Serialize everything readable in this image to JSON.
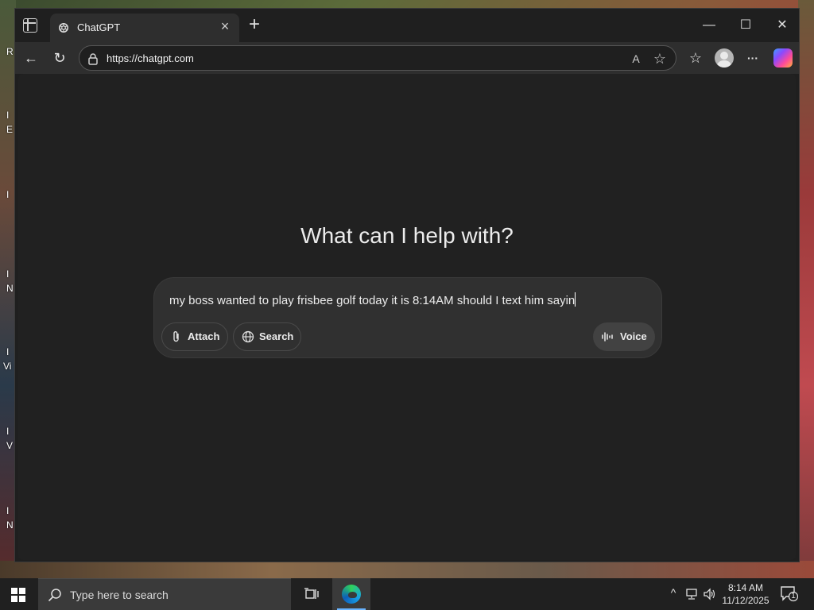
{
  "browser": {
    "tab_title": "ChatGPT",
    "url": "https://chatgpt.com",
    "new_tab_glyph": "+",
    "tab_close_glyph": "×"
  },
  "window_controls": {
    "minimize": "—",
    "maximize": "☐",
    "close": "✕"
  },
  "toolbar_icons": {
    "back": "←",
    "refresh": "↻",
    "read_aloud": "A",
    "favorite": "☆",
    "favorites_list": "☆",
    "more": "···"
  },
  "page": {
    "heading": "What can I help with?",
    "prompt_value": "my boss wanted to play frisbee golf today it is 8:14AM should I text him sayin",
    "attach_label": "Attach",
    "search_label": "Search",
    "voice_label": "Voice"
  },
  "desktop": {
    "letters": [
      "R",
      "I",
      "E",
      "I",
      "I",
      "N",
      "I",
      "Vi",
      "I",
      "V",
      "I",
      "N"
    ]
  },
  "taskbar": {
    "search_placeholder": "Type here to search",
    "time": "8:14 AM",
    "date": "11/12/2025",
    "notification_count": "1"
  },
  "colors": {
    "page_bg": "#212121",
    "composer_bg": "#303030",
    "accent": "#6ab4ff"
  }
}
